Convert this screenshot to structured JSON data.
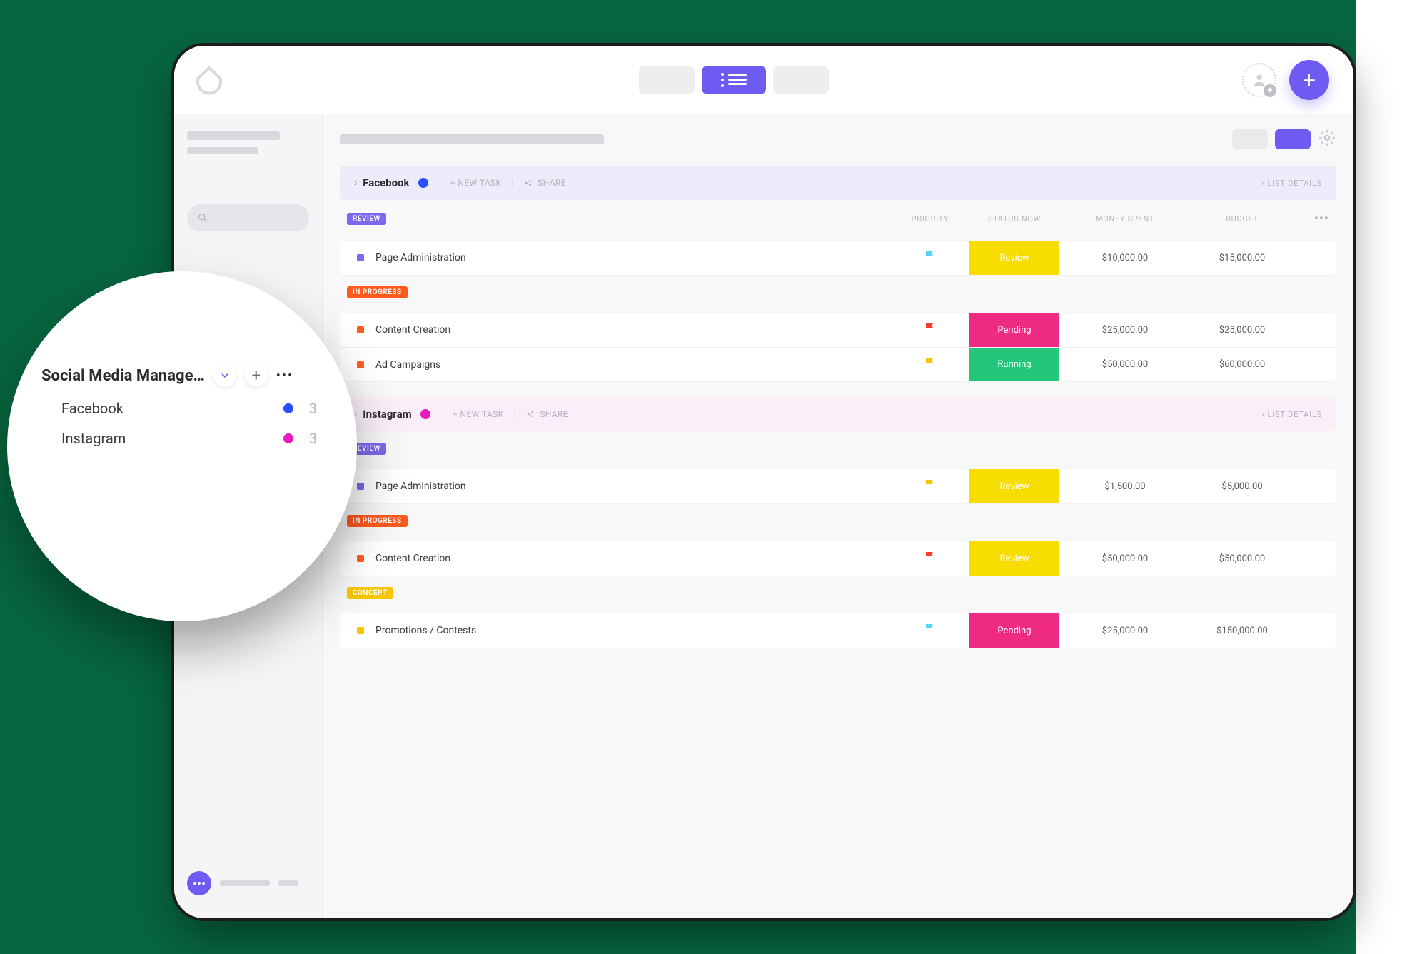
{
  "sidebar_zoom": {
    "title": "Social Media Manage…",
    "items": [
      {
        "name": "Facebook",
        "count": "3",
        "color": "#2b4eff"
      },
      {
        "name": "Instagram",
        "count": "3",
        "color": "#e81bc0"
      }
    ]
  },
  "header_actions": {
    "new_task": "+ NEW TASK",
    "share": "SHARE",
    "list_details": "LIST DETAILS"
  },
  "columns": {
    "priority": "PRIORITY",
    "status_now": "STATUS NOW",
    "money_spent": "MONEY SPENT",
    "budget": "BUDGET"
  },
  "status_tags": {
    "review": "REVIEW",
    "in_progress": "IN PROGRESS",
    "concept": "CONCEPT"
  },
  "groups": [
    {
      "name": "Facebook",
      "dot": "blue",
      "header_class": "gh-fb",
      "sections": [
        {
          "tag": "review",
          "tasks": [
            {
              "bullet": "b-purple",
              "name": "Page Administration",
              "flag": "cyan",
              "status": "Review",
              "status_class": "sp-review",
              "money": "$10,000.00",
              "budget": "$15,000.00"
            }
          ]
        },
        {
          "tag": "in_progress",
          "tasks": [
            {
              "bullet": "b-orange",
              "name": "Content Creation",
              "flag": "red",
              "status": "Pending",
              "status_class": "sp-pending",
              "money": "$25,000.00",
              "budget": "$25,000.00"
            },
            {
              "bullet": "b-orange",
              "name": "Ad Campaigns",
              "flag": "yellow",
              "status": "Running",
              "status_class": "sp-running",
              "money": "$50,000.00",
              "budget": "$60,000.00"
            }
          ]
        }
      ]
    },
    {
      "name": "Instagram",
      "dot": "pink",
      "header_class": "gh-ig",
      "sections": [
        {
          "tag": "review",
          "tasks": [
            {
              "bullet": "b-purple",
              "name": "Page Administration",
              "flag": "yellow",
              "status": "Review",
              "status_class": "sp-review",
              "money": "$1,500.00",
              "budget": "$5,000.00"
            }
          ]
        },
        {
          "tag": "in_progress",
          "tasks": [
            {
              "bullet": "b-orange",
              "name": "Content Creation",
              "flag": "red",
              "status": "Review",
              "status_class": "sp-review",
              "money": "$50,000.00",
              "budget": "$50,000.00"
            }
          ]
        },
        {
          "tag": "concept",
          "tasks": [
            {
              "bullet": "b-yellow",
              "name": "Promotions / Contests",
              "flag": "cyan",
              "status": "Pending",
              "status_class": "sp-pending",
              "money": "$25,000.00",
              "budget": "$150,000.00"
            }
          ]
        }
      ]
    }
  ]
}
